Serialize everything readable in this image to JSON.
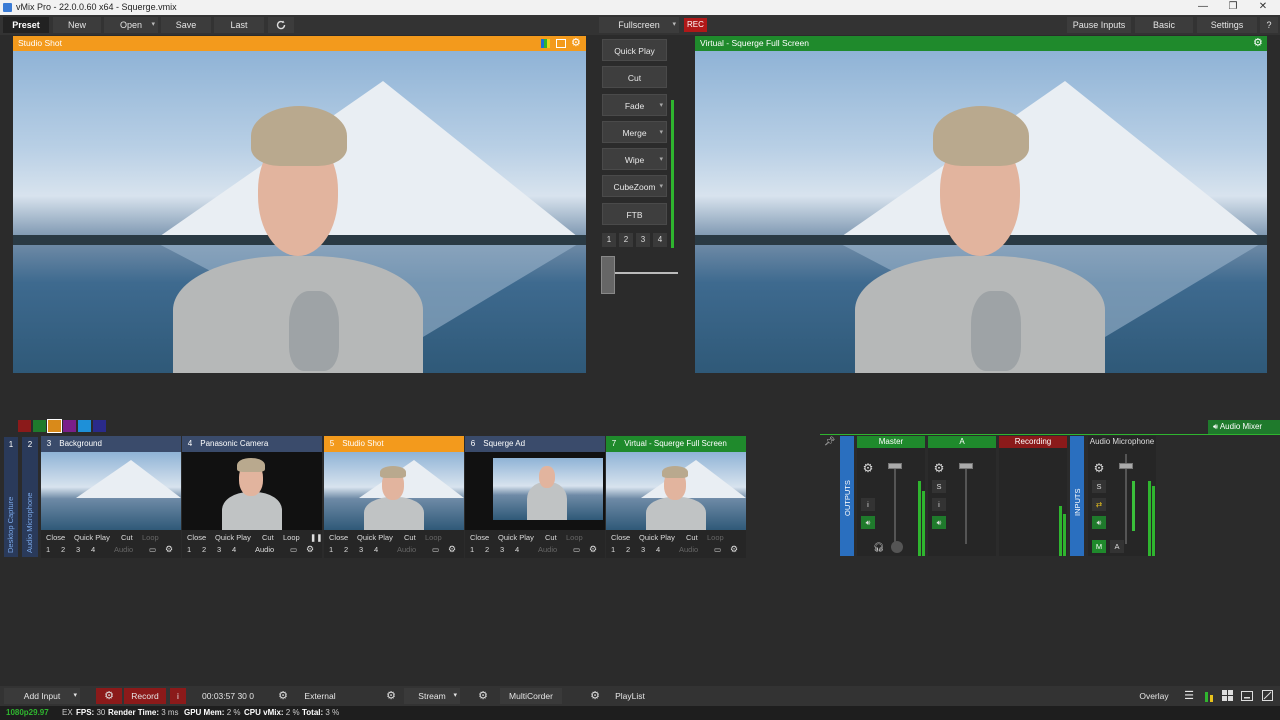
{
  "window": {
    "title": "vMix Pro - 22.0.0.60 x64 - Squerge.vmix",
    "minimize": "—",
    "restore": "❐",
    "close": "✕"
  },
  "toolbar": {
    "preset": "Preset",
    "new": "New",
    "open": "Open",
    "save": "Save",
    "last": "Last",
    "fullscreen": "Fullscreen",
    "rec": "REC",
    "pause_inputs": "Pause Inputs",
    "basic": "Basic",
    "settings": "Settings",
    "help": "?"
  },
  "preview": {
    "title": "Studio Shot",
    "header_color": "#f39a1c"
  },
  "output": {
    "title": "Virtual - Squerge Full Screen",
    "header_color": "#1f8a2c"
  },
  "transitions": {
    "buttons": [
      {
        "label": "Quick Play",
        "dropdown": false
      },
      {
        "label": "Cut",
        "dropdown": false
      },
      {
        "label": "Fade",
        "dropdown": true
      },
      {
        "label": "Merge",
        "dropdown": true
      },
      {
        "label": "Wipe",
        "dropdown": true
      },
      {
        "label": "CubeZoom",
        "dropdown": true
      },
      {
        "label": "FTB",
        "dropdown": false
      }
    ],
    "numbers": [
      "1",
      "2",
      "3",
      "4"
    ]
  },
  "color_swatches": [
    "#8b1a1a",
    "#1f7a2c",
    "#d98a1a",
    "#7a1f8a",
    "#1e90d8",
    "#2a2a8a"
  ],
  "side_tabs": {
    "num1": "1",
    "num2": "2",
    "desktop_capture": "Desktop Capture",
    "audio_microphone": "Audio Microphone"
  },
  "inputs": [
    {
      "num": "3",
      "name": "Background",
      "hdr_color": "#3a4b6b",
      "audio": "Audio",
      "audio_dim": true
    },
    {
      "num": "4",
      "name": "Panasonic Camera",
      "hdr_color": "#3a4b6b",
      "audio": "Audio",
      "audio_dim": false
    },
    {
      "num": "5",
      "name": "Studio Shot",
      "hdr_color": "#f39a1c",
      "audio": "Audio",
      "audio_dim": true
    },
    {
      "num": "6",
      "name": "Squerge Ad",
      "hdr_color": "#3a4b6b",
      "audio": "Audio",
      "audio_dim": true
    },
    {
      "num": "7",
      "name": "Virtual - Squerge Full Screen",
      "hdr_color": "#1f8a2c",
      "audio": "Audio",
      "audio_dim": true
    }
  ],
  "input_controls": {
    "close": "Close",
    "quick_play": "Quick Play",
    "cut": "Cut",
    "loop": "Loop",
    "numbers": [
      "1",
      "2",
      "3",
      "4"
    ]
  },
  "audio_mixer": {
    "label": "Audio Mixer",
    "outputs_label": "OUTPUTS",
    "inputs_label": "INPUTS",
    "master": "Master",
    "bus_a": "A",
    "recording": "Recording",
    "microphone": "Audio Microphone",
    "s": "S",
    "i": "i",
    "m": "M",
    "a": "A"
  },
  "bottom": {
    "add_input": "Add Input",
    "record": "Record",
    "record_info": "i",
    "timecode": "00:03:57 30 0",
    "external": "External",
    "stream": "Stream",
    "multicorder": "MultiCorder",
    "playlist": "PlayList",
    "overlay": "Overlay"
  },
  "status": {
    "resolution": "1080p29.97",
    "ex": "EX",
    "fps_label": "FPS:",
    "fps": "30",
    "render_label": "Render Time:",
    "render": "3 ms",
    "gpu_label": "GPU Mem:",
    "gpu": "2 %",
    "cpu_label": "CPU vMix:",
    "cpu": "2 %",
    "total_label": "Total:",
    "total": "3 %"
  }
}
